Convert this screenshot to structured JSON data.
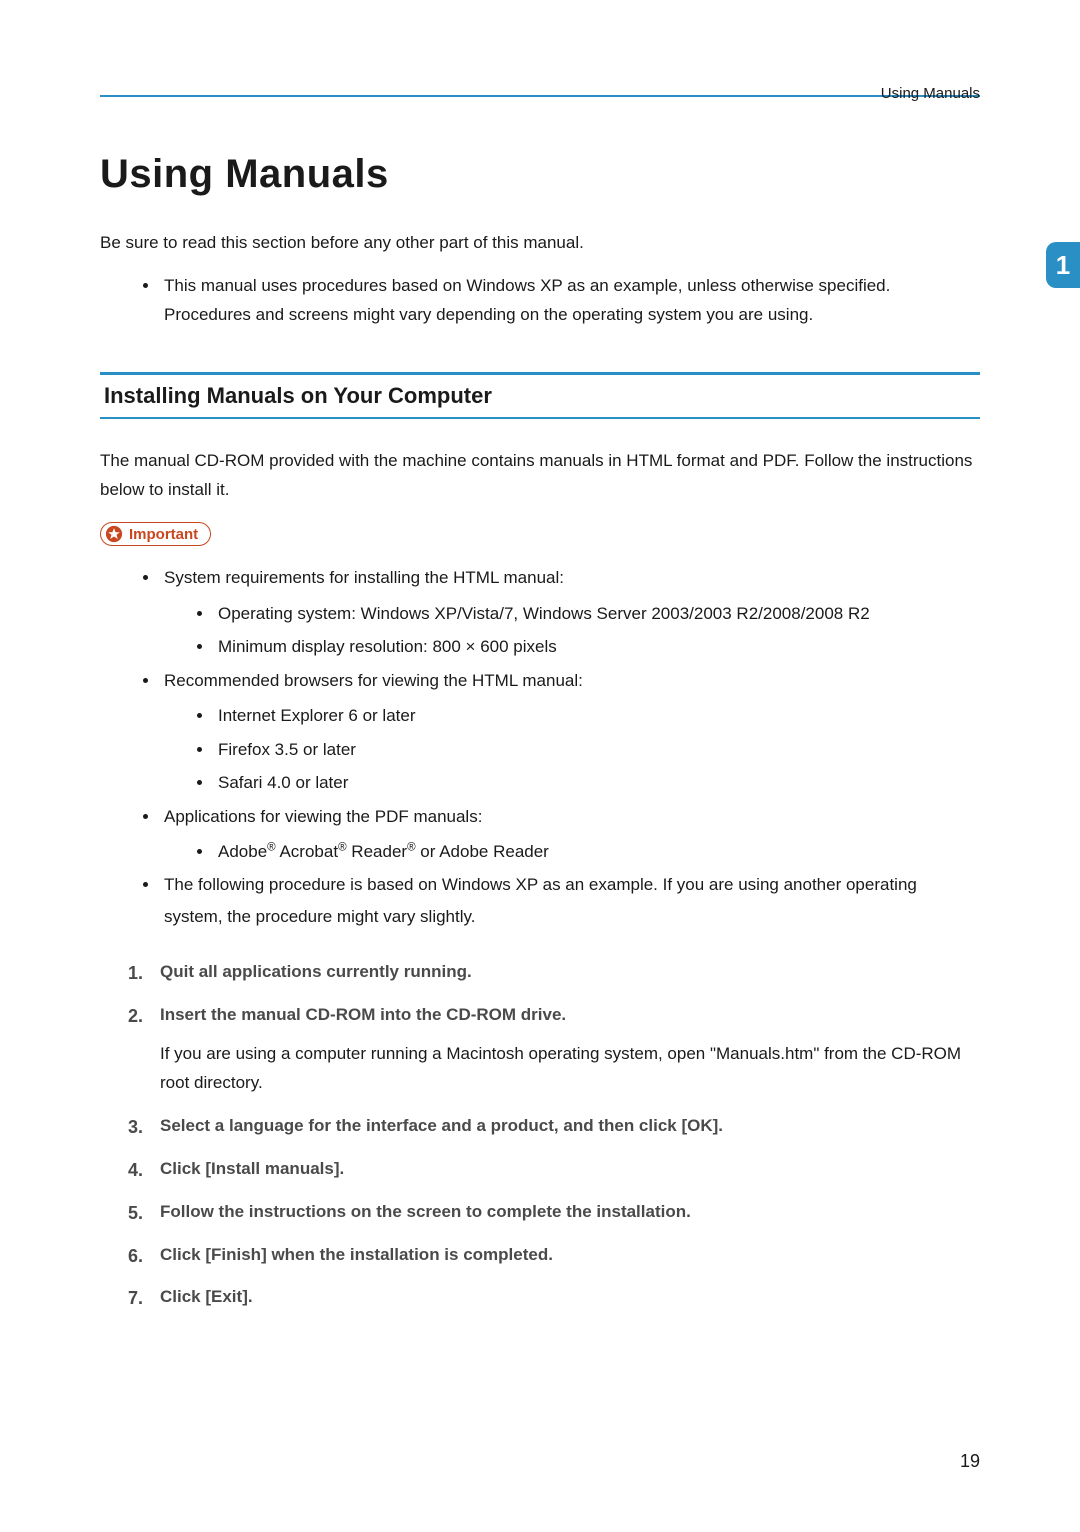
{
  "header": {
    "breadcrumb": "Using Manuals",
    "chapter_tab": "1"
  },
  "title": "Using Manuals",
  "intro": "Be sure to read this section before any other part of this manual.",
  "top_bullets": [
    "This manual uses procedures based on Windows XP as an example, unless otherwise specified. Procedures and screens might vary depending on the operating system you are using."
  ],
  "section": {
    "heading": "Installing Manuals on Your Computer",
    "intro": "The manual CD-ROM provided with the machine contains manuals in HTML format and PDF. Follow the instructions below to install it.",
    "important_label": "Important",
    "important_items": {
      "i0": "System requirements for installing the HTML manual:",
      "i0_sub": {
        "s0": "Operating system: Windows XP/Vista/7, Windows Server 2003/2003 R2/2008/2008 R2",
        "s1": "Minimum display resolution: 800 × 600 pixels"
      },
      "i1": "Recommended browsers for viewing the HTML manual:",
      "i1_sub": {
        "s0": "Internet Explorer 6 or later",
        "s1": "Firefox 3.5 or later",
        "s2": "Safari 4.0 or later"
      },
      "i2": "Applications for viewing the PDF manuals:",
      "i2_sub": {
        "s0_pre": "Adobe",
        "s0_mid": " Acrobat",
        "s0_mid2": " Reader",
        "s0_post": " or Adobe Reader",
        "reg": "®"
      },
      "i3": "The following procedure is based on Windows XP as an example. If you are using another operating system, the procedure might vary slightly."
    },
    "steps": [
      {
        "title": "Quit all applications currently running."
      },
      {
        "title": "Insert the manual CD-ROM into the CD-ROM drive.",
        "body": "If you are using a computer running a Macintosh operating system, open \"Manuals.htm\" from the CD-ROM root directory."
      },
      {
        "title": "Select a language for the interface and a product, and then click [OK]."
      },
      {
        "title": "Click [Install manuals]."
      },
      {
        "title": "Follow the instructions on the screen to complete the installation."
      },
      {
        "title": "Click [Finish] when the installation is completed."
      },
      {
        "title": "Click [Exit]."
      }
    ]
  },
  "page_number": "19"
}
